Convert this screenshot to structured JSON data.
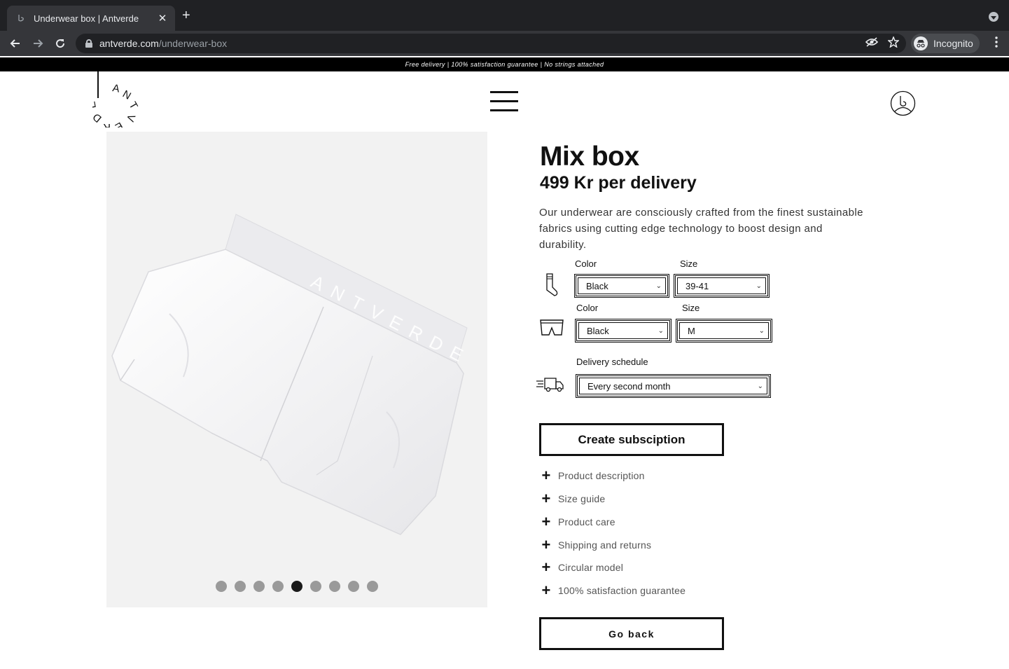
{
  "browser": {
    "tab_title": "Underwear box | Antverde",
    "tab_close": "✕",
    "new_tab": "+",
    "url_host": "antverde.com",
    "url_path": "/underwear-box",
    "profile_label": "Incognito"
  },
  "promo_bar": "Free delivery | 100% satisfaction guarantee | No strings attached",
  "brand": {
    "logo_text": "ANTVERDE"
  },
  "gallery": {
    "slide_count": 9,
    "active_index": 5
  },
  "product": {
    "title": "Mix box",
    "price": "499 Kr per delivery",
    "description": "Our underwear are consciously crafted from the finest sustainable fabrics using cutting edge technology to boost design and durability."
  },
  "options": {
    "socks": {
      "color_label": "Color",
      "size_label": "Size",
      "color_value": "Black",
      "size_value": "39-41"
    },
    "underwear": {
      "color_label": "Color",
      "size_label": "Size",
      "color_value": "Black",
      "size_value": "M"
    },
    "delivery": {
      "label": "Delivery schedule",
      "value": "Every second month"
    }
  },
  "actions": {
    "create_label": "Create subsciption",
    "back_label": "Go back"
  },
  "accordion": [
    "Product description",
    "Size guide",
    "Product care",
    "Shipping and returns",
    "Circular model",
    "100% satisfaction guarantee"
  ],
  "colors": {
    "chrome_dark": "#202124",
    "chrome_toolbar": "#35363a",
    "gallery_bg": "#f2f2f2",
    "dot_active": "#1a1a1a",
    "dot_inactive": "#9a9a9a"
  }
}
